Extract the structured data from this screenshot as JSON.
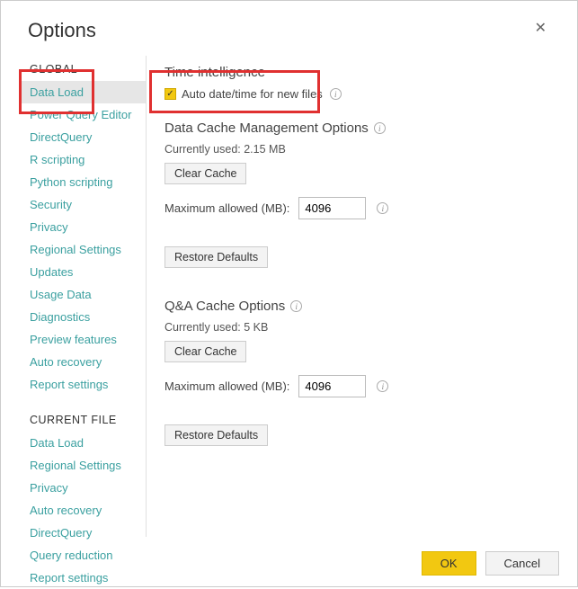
{
  "dialog": {
    "title": "Options"
  },
  "sidebar": {
    "global_header": "GLOBAL",
    "current_file_header": "CURRENT FILE",
    "global_items": [
      "Data Load",
      "Power Query Editor",
      "DirectQuery",
      "R scripting",
      "Python scripting",
      "Security",
      "Privacy",
      "Regional Settings",
      "Updates",
      "Usage Data",
      "Diagnostics",
      "Preview features",
      "Auto recovery",
      "Report settings"
    ],
    "current_file_items": [
      "Data Load",
      "Regional Settings",
      "Privacy",
      "Auto recovery",
      "DirectQuery",
      "Query reduction",
      "Report settings"
    ]
  },
  "content": {
    "time_intelligence": {
      "title": "Time intelligence",
      "checkbox_label": "Auto date/time for new files"
    },
    "data_cache": {
      "title": "Data Cache Management Options",
      "currently_used_label": "Currently used: 2.15 MB",
      "clear_btn": "Clear Cache",
      "max_label": "Maximum allowed (MB):",
      "max_value": "4096",
      "restore_btn": "Restore Defaults"
    },
    "qa_cache": {
      "title": "Q&A Cache Options",
      "currently_used_label": "Currently used: 5 KB",
      "clear_btn": "Clear Cache",
      "max_label": "Maximum allowed (MB):",
      "max_value": "4096",
      "restore_btn": "Restore Defaults"
    }
  },
  "footer": {
    "ok": "OK",
    "cancel": "Cancel"
  }
}
